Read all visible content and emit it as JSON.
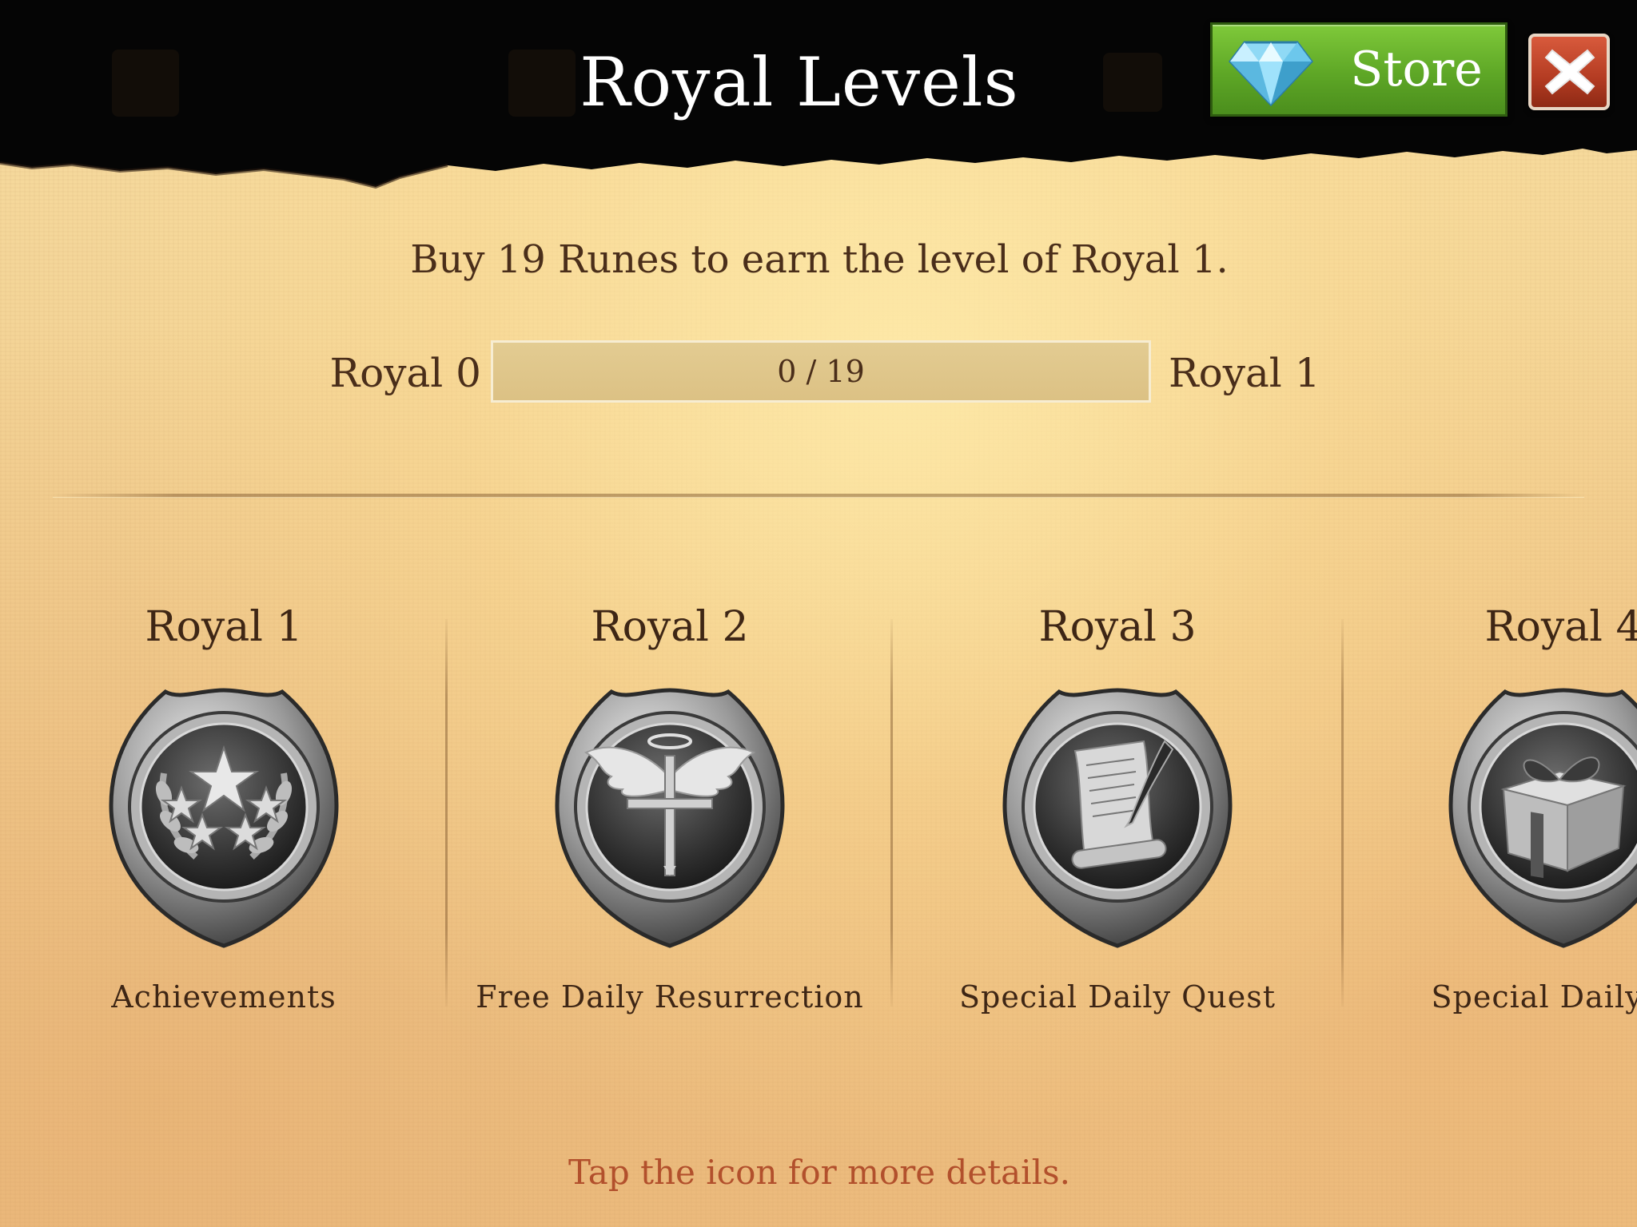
{
  "header": {
    "title": "Royal Levels",
    "store_label": "Store",
    "store_icon": "diamond-icon",
    "close_icon": "close-x-icon"
  },
  "info": {
    "headline": "Buy 19 Runes to earn the level of Royal 1."
  },
  "progress": {
    "current_level": "Royal 0",
    "next_level": "Royal 1",
    "text": "0 / 19",
    "value": 0,
    "max": 19
  },
  "levels": [
    {
      "title": "Royal 1",
      "label": "Achievements",
      "icon": "laurel-stars-icon"
    },
    {
      "title": "Royal 2",
      "label": "Free Daily Resurrection",
      "icon": "winged-cross-icon"
    },
    {
      "title": "Royal 3",
      "label": "Special Daily Quest",
      "icon": "scroll-quill-icon"
    },
    {
      "title": "Royal 4",
      "label": "Special Daily Bo",
      "icon": "gift-box-icon"
    }
  ],
  "footer": {
    "hint": "Tap the icon for more details."
  },
  "colors": {
    "store_green": "#5ea726",
    "close_red": "#b33b22",
    "text_brown": "#4a2e1a",
    "hint_red": "#b2502c"
  }
}
